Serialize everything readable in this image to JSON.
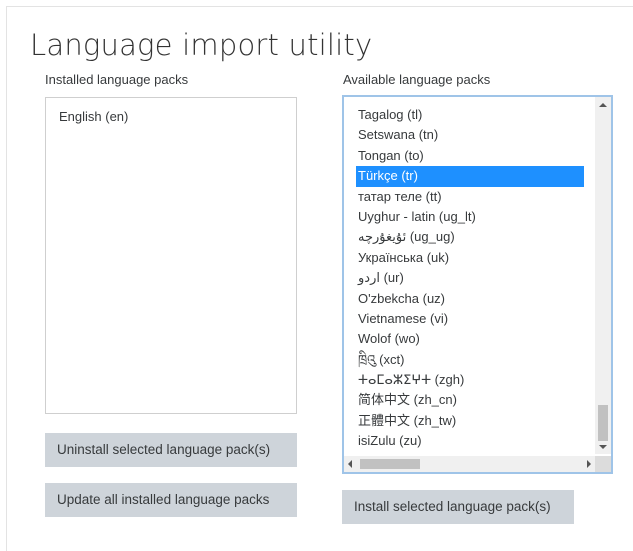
{
  "page": {
    "title": "Language import utility"
  },
  "installed": {
    "label": "Installed language packs",
    "items": [
      "English (en)"
    ]
  },
  "available": {
    "label": "Available language packs",
    "items": [
      "Tagalog (tl)",
      "Setswana (tn)",
      "Tongan (to)",
      "Türkçe (tr)",
      "татар теле (tt)",
      "Uyghur - latin (ug_lt)",
      "ئۇيغۇرچە (ug_ug)",
      "Українська (uk)",
      "اردو (ur)",
      "O'zbekcha (uz)",
      "Vietnamese (vi)",
      "Wolof (wo)",
      "ཁྲིའུ (xct)",
      "ⵜⴰⵎⴰⵣⵉⵖⵜ (zgh)",
      "简体中文 (zh_cn)",
      "正體中文 (zh_tw)",
      "isiZulu (zu)"
    ],
    "selected": "Türkçe (tr)"
  },
  "buttons": {
    "uninstall": "Uninstall selected language pack(s)",
    "update": "Update all installed language packs",
    "install": "Install selected language pack(s)"
  },
  "colors": {
    "selection": "#1e90ff",
    "button_bg": "#ced4da",
    "focus_border": "#9fc4e8"
  }
}
